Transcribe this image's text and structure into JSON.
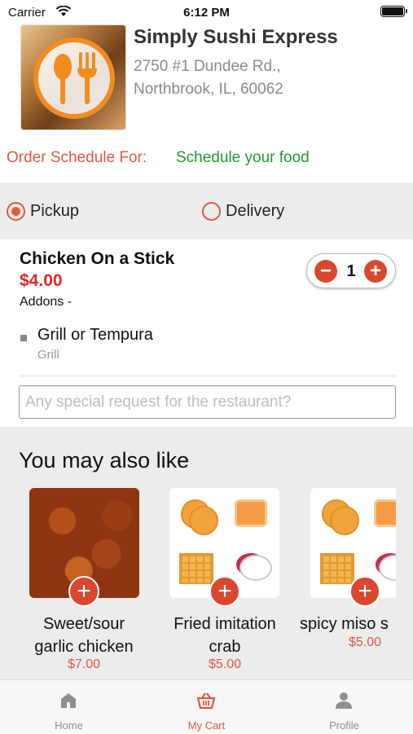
{
  "status_bar": {
    "carrier": "Carrier",
    "time": "6:12 PM"
  },
  "restaurant": {
    "name": "Simply Sushi Express",
    "address_line1": "2750 #1 Dundee Rd.,",
    "address_line2": "Northbrook, IL, 60062"
  },
  "schedule": {
    "label": "Order Schedule For:",
    "value": "Schedule your food"
  },
  "order_mode": {
    "pickup": "Pickup",
    "delivery": "Delivery",
    "selected": "Pickup"
  },
  "item": {
    "name": "Chicken On a Stick",
    "price": "$4.00",
    "addons_label": "Addons -",
    "quantity": "1",
    "addon": {
      "name": "Grill or Tempura",
      "value": "Grill"
    }
  },
  "special_request": {
    "placeholder": "Any special request for the restaurant?",
    "value": ""
  },
  "suggestions": {
    "title": "You may also like",
    "items": [
      {
        "name_line1": "Sweet/sour",
        "name_line2": "garlic chicken",
        "price": "$7.00"
      },
      {
        "name_line1": "Fried imitation",
        "name_line2": "crab",
        "price": "$5.00"
      },
      {
        "name_line1": "spicy miso s",
        "name_line2": "",
        "price": "$5.00"
      }
    ]
  },
  "tabbar": {
    "tabs": [
      {
        "label": "Home",
        "icon": "home-icon"
      },
      {
        "label": "My Cart",
        "icon": "cart-icon"
      },
      {
        "label": "Profile",
        "icon": "profile-icon"
      }
    ],
    "active": "My Cart"
  },
  "colors": {
    "accent": "#e0583f",
    "price": "#e02a2a",
    "schedule": "#1a9c2b",
    "logo_orange": "#f28c1f"
  }
}
